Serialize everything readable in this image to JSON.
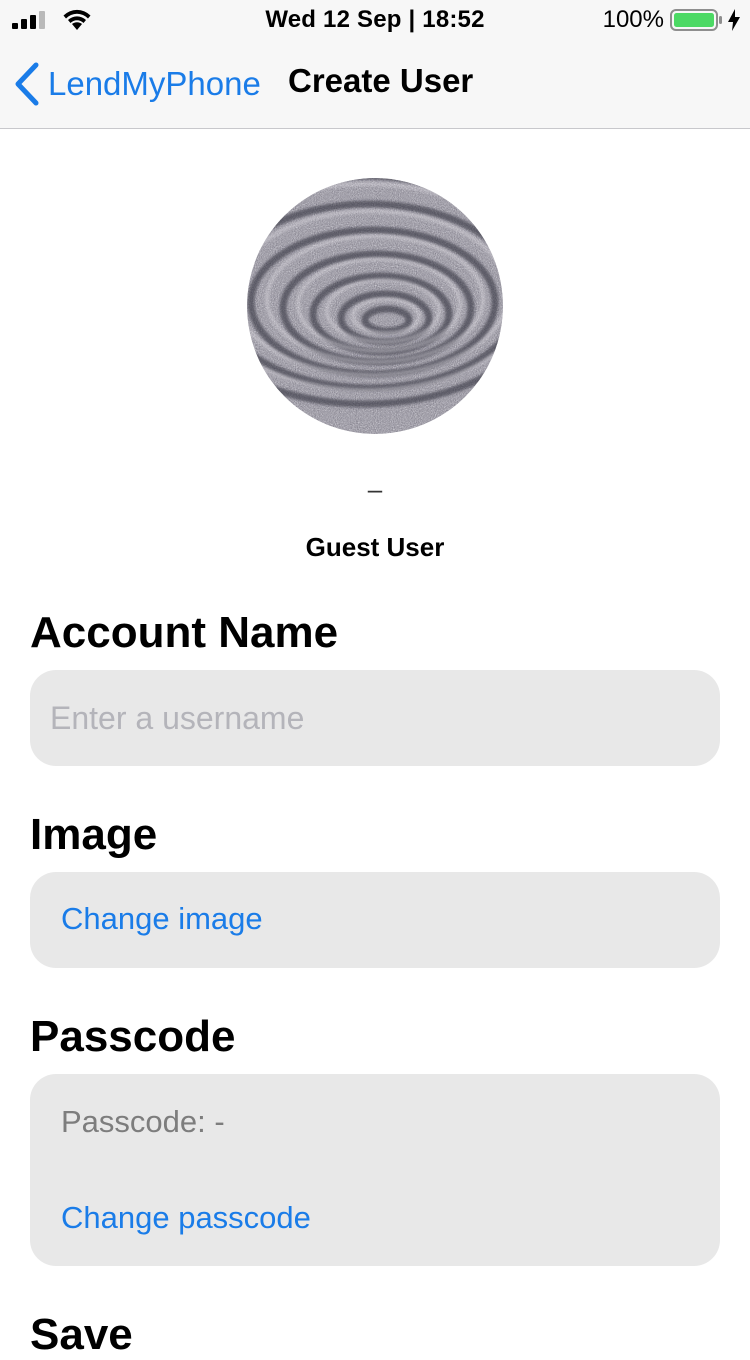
{
  "status_bar": {
    "time": "Wed 12 Sep | 18:52",
    "battery_percent": "100%",
    "icons": [
      "cellular-signal-icon",
      "wifi-icon",
      "battery-icon",
      "charging-bolt-icon"
    ]
  },
  "nav": {
    "back_label": "LendMyPhone",
    "title": "Create User",
    "accent_color": "#1a7ce8"
  },
  "profile": {
    "dash": "–",
    "name": "Guest User"
  },
  "sections": {
    "account_name": {
      "heading": "Account Name",
      "input_value": "",
      "placeholder": "Enter a username"
    },
    "image": {
      "heading": "Image",
      "change_label": "Change image"
    },
    "passcode": {
      "heading": "Passcode",
      "status_label": "Passcode: -",
      "change_label": "Change passcode"
    },
    "save": {
      "heading": "Save"
    }
  }
}
